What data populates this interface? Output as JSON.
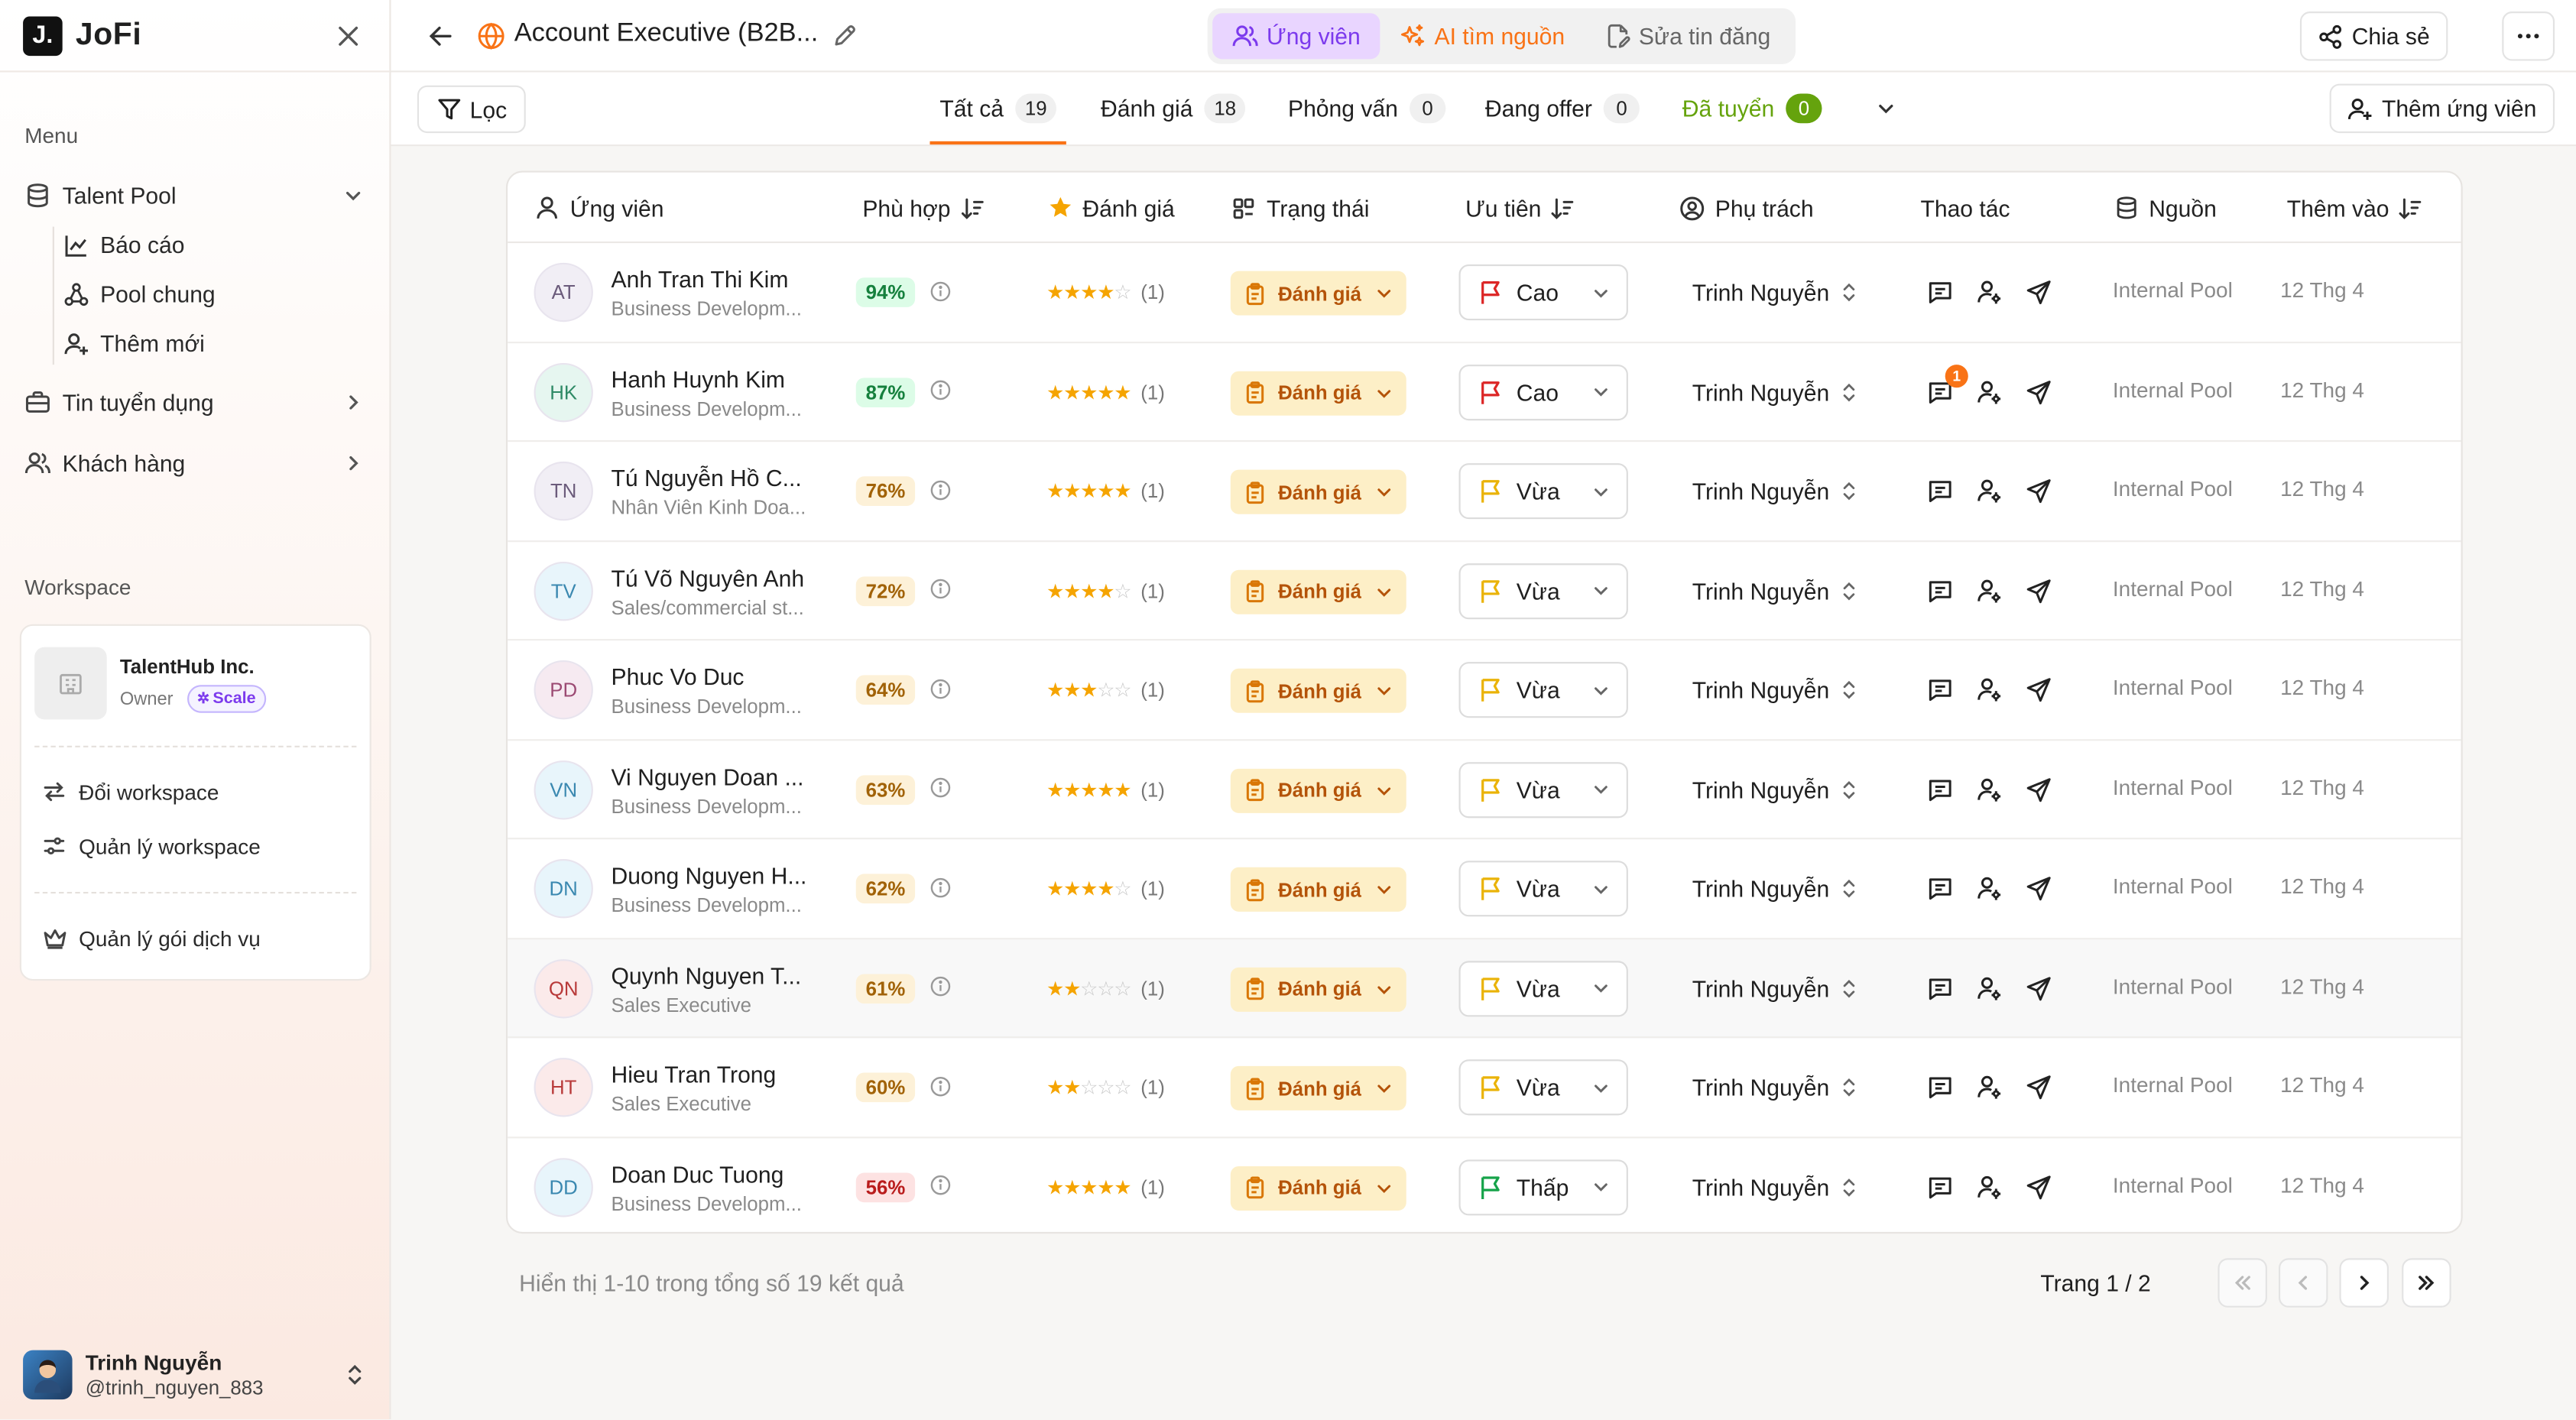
{
  "sidebar": {
    "logo_mark": "J.",
    "logo_text": "JoFi",
    "menu_label": "Menu",
    "talent_pool": "Talent Pool",
    "sub_items": [
      {
        "label": "Báo cáo",
        "icon": "chart-line-icon"
      },
      {
        "label": "Pool chung",
        "icon": "network-icon"
      },
      {
        "label": "Thêm mới",
        "icon": "user-plus-icon"
      }
    ],
    "jobs": "Tin tuyển dụng",
    "clients": "Khách hàng",
    "workspace_label": "Workspace",
    "workspace": {
      "name": "TalentHub Inc.",
      "role": "Owner",
      "plan": "Scale",
      "switch": "Đổi workspace",
      "manage": "Quản lý workspace",
      "billing": "Quản lý gói dịch vụ"
    },
    "user": {
      "name": "Trinh Nguyễn",
      "handle": "@trinh_nguyen_883"
    }
  },
  "header": {
    "title": "Account Executive (B2B...",
    "seg": [
      "Ứng viên",
      "AI tìm nguồn",
      "Sửa tin đăng"
    ],
    "share": "Chia sẻ"
  },
  "toolbar": {
    "filter": "Lọc",
    "tabs": [
      {
        "label": "Tất cả",
        "count": "19"
      },
      {
        "label": "Đánh giá",
        "count": "18"
      },
      {
        "label": "Phỏng vấn",
        "count": "0"
      },
      {
        "label": "Đang offer",
        "count": "0"
      },
      {
        "label": "Đã tuyển",
        "count": "0"
      }
    ],
    "add_candidate": "Thêm ứng viên"
  },
  "table": {
    "columns": {
      "candidate": "Ứng viên",
      "match": "Phù hợp",
      "rating": "Đánh giá",
      "status": "Trạng thái",
      "priority": "Ưu tiên",
      "owner": "Phụ trách",
      "actions": "Thao tác",
      "source": "Nguồn",
      "added": "Thêm vào"
    },
    "rows": [
      {
        "initials": "AT",
        "name": "Anh Tran Thi Kim",
        "role": "Business Developm...",
        "match": "94%",
        "stars": 4,
        "rating_count": "(1)",
        "status": "Đánh giá",
        "priority": "Cao",
        "owner": "Trinh Nguyễn",
        "source": "Internal Pool",
        "added": "12 Thg 4",
        "av_bg": "#f1eef5",
        "av_fg": "#6b5b7b",
        "match_bg": "#dcfce7",
        "match_fg": "#15803d",
        "flag": "#dc2626",
        "notif": ""
      },
      {
        "initials": "HK",
        "name": "Hanh Huynh Kim",
        "role": "Business Developm...",
        "match": "87%",
        "stars": 5,
        "rating_count": "(1)",
        "status": "Đánh giá",
        "priority": "Cao",
        "owner": "Trinh Nguyễn",
        "source": "Internal Pool",
        "added": "12 Thg 4",
        "av_bg": "#e6f6f0",
        "av_fg": "#2f8a66",
        "match_bg": "#dcfce7",
        "match_fg": "#15803d",
        "flag": "#dc2626",
        "notif": "1"
      },
      {
        "initials": "TN",
        "name": "Tú Nguyễn Hồ C...",
        "role": "Nhân Viên Kinh Doa...",
        "match": "76%",
        "stars": 5,
        "rating_count": "(1)",
        "status": "Đánh giá",
        "priority": "Vừa",
        "owner": "Trinh Nguyễn",
        "source": "Internal Pool",
        "added": "12 Thg 4",
        "av_bg": "#f1eef5",
        "av_fg": "#6b5b7b",
        "match_bg": "#fdf1d8",
        "match_fg": "#a16207",
        "flag": "#eab308",
        "notif": ""
      },
      {
        "initials": "TV",
        "name": "Tú Võ Nguyên Anh",
        "role": "Sales/commercial st...",
        "match": "72%",
        "stars": 4,
        "rating_count": "(1)",
        "status": "Đánh giá",
        "priority": "Vừa",
        "owner": "Trinh Nguyễn",
        "source": "Internal Pool",
        "added": "12 Thg 4",
        "av_bg": "#e8f5fb",
        "av_fg": "#3a88b0",
        "match_bg": "#fdf1d8",
        "match_fg": "#a16207",
        "flag": "#eab308",
        "notif": ""
      },
      {
        "initials": "PD",
        "name": "Phuc Vo Duc",
        "role": "Business Developm...",
        "match": "64%",
        "stars": 3,
        "rating_count": "(1)",
        "status": "Đánh giá",
        "priority": "Vừa",
        "owner": "Trinh Nguyễn",
        "source": "Internal Pool",
        "added": "12 Thg 4",
        "av_bg": "#f6eaf1",
        "av_fg": "#9b4a73",
        "match_bg": "#fdf1d8",
        "match_fg": "#a16207",
        "flag": "#eab308",
        "notif": ""
      },
      {
        "initials": "VN",
        "name": "Vi Nguyen Doan ...",
        "role": "Business Developm...",
        "match": "63%",
        "stars": 5,
        "rating_count": "(1)",
        "status": "Đánh giá",
        "priority": "Vừa",
        "owner": "Trinh Nguyễn",
        "source": "Internal Pool",
        "added": "12 Thg 4",
        "av_bg": "#e8f5fb",
        "av_fg": "#3a88b0",
        "match_bg": "#fdf1d8",
        "match_fg": "#a16207",
        "flag": "#eab308",
        "notif": ""
      },
      {
        "initials": "DN",
        "name": "Duong Nguyen H...",
        "role": "Business Developm...",
        "match": "62%",
        "stars": 4,
        "rating_count": "(1)",
        "status": "Đánh giá",
        "priority": "Vừa",
        "owner": "Trinh Nguyễn",
        "source": "Internal Pool",
        "added": "12 Thg 4",
        "av_bg": "#e8f5fb",
        "av_fg": "#3a88b0",
        "match_bg": "#fdf1d8",
        "match_fg": "#a16207",
        "flag": "#eab308",
        "notif": ""
      },
      {
        "initials": "QN",
        "name": "Quynh Nguyen T...",
        "role": "Sales Executive",
        "match": "61%",
        "stars": 2,
        "rating_count": "(1)",
        "status": "Đánh giá",
        "priority": "Vừa",
        "owner": "Trinh Nguyễn",
        "source": "Internal Pool",
        "added": "12 Thg 4",
        "av_bg": "#fbeaea",
        "av_fg": "#b83a3a",
        "match_bg": "#fdf1d8",
        "match_fg": "#a16207",
        "flag": "#eab308",
        "notif": ""
      },
      {
        "initials": "HT",
        "name": "Hieu Tran Trong",
        "role": "Sales Executive",
        "match": "60%",
        "stars": 2,
        "rating_count": "(1)",
        "status": "Đánh giá",
        "priority": "Vừa",
        "owner": "Trinh Nguyễn",
        "source": "Internal Pool",
        "added": "12 Thg 4",
        "av_bg": "#fbeaea",
        "av_fg": "#b83a3a",
        "match_bg": "#fdf1d8",
        "match_fg": "#a16207",
        "flag": "#eab308",
        "notif": ""
      },
      {
        "initials": "DD",
        "name": "Doan Duc Tuong",
        "role": "Business Developm...",
        "match": "56%",
        "stars": 5,
        "rating_count": "(1)",
        "status": "Đánh giá",
        "priority": "Thấp",
        "owner": "Trinh Nguyễn",
        "source": "Internal Pool",
        "added": "12 Thg 4",
        "av_bg": "#e8f5fb",
        "av_fg": "#3a88b0",
        "match_bg": "#fde2e2",
        "match_fg": "#b91c1c",
        "flag": "#16a34a",
        "notif": ""
      }
    ]
  },
  "footer": {
    "summary": "Hiển thị 1-10 trong tổng số 19 kết quả",
    "page": "Trang 1 / 2"
  }
}
